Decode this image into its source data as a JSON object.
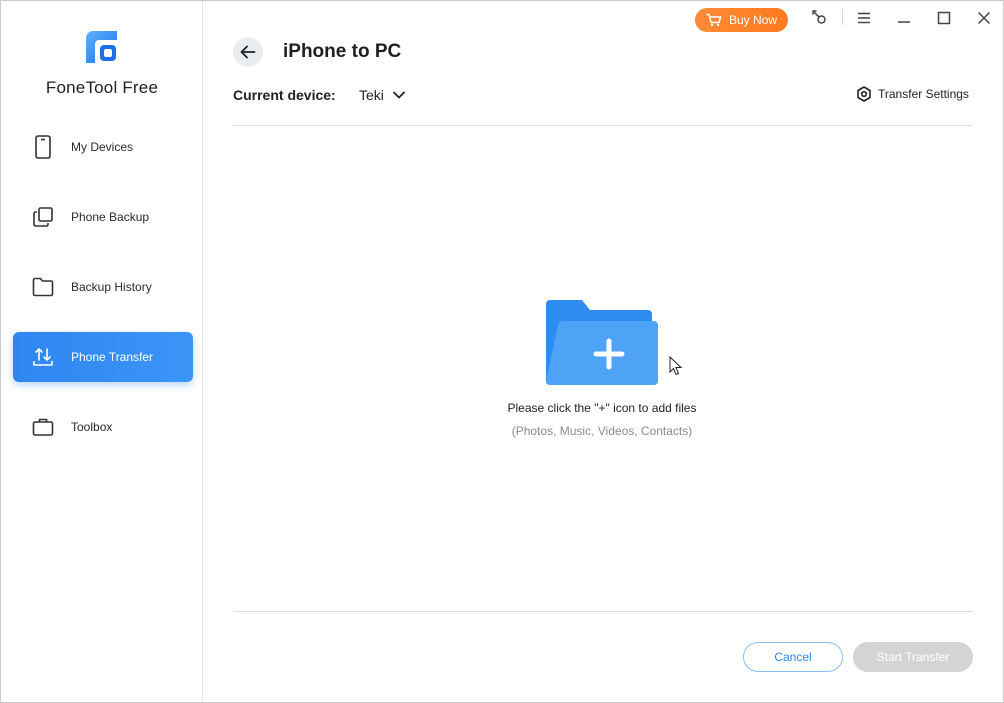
{
  "app": {
    "name": "FoneTool Free"
  },
  "sidebar": {
    "items": [
      {
        "label": "My Devices",
        "icon": "phone-icon"
      },
      {
        "label": "Phone Backup",
        "icon": "backup-icon"
      },
      {
        "label": "Backup History",
        "icon": "folder-icon"
      },
      {
        "label": "Phone Transfer",
        "icon": "transfer-icon",
        "active": true
      },
      {
        "label": "Toolbox",
        "icon": "toolbox-icon"
      }
    ]
  },
  "titlebar": {
    "buy_now": "Buy Now",
    "icons": [
      "cart-icon",
      "key-icon",
      "menu-icon",
      "minimize-icon",
      "maximize-icon",
      "close-icon"
    ]
  },
  "header": {
    "title": "iPhone to PC",
    "device_label": "Current device:",
    "device_value": "Teki",
    "settings_label": "Transfer Settings"
  },
  "dropzone": {
    "hint": "Please click the \"+\" icon to add files",
    "subhint": "(Photos, Music, Videos, Contacts)"
  },
  "footer": {
    "cancel": "Cancel",
    "start": "Start Transfer"
  },
  "colors": {
    "accent": "#2f86f0",
    "buy_now": "#ff8330",
    "disabled": "#d4d4d4",
    "folder_back": "#2d8df0",
    "folder_front": "#4ea3f7"
  }
}
